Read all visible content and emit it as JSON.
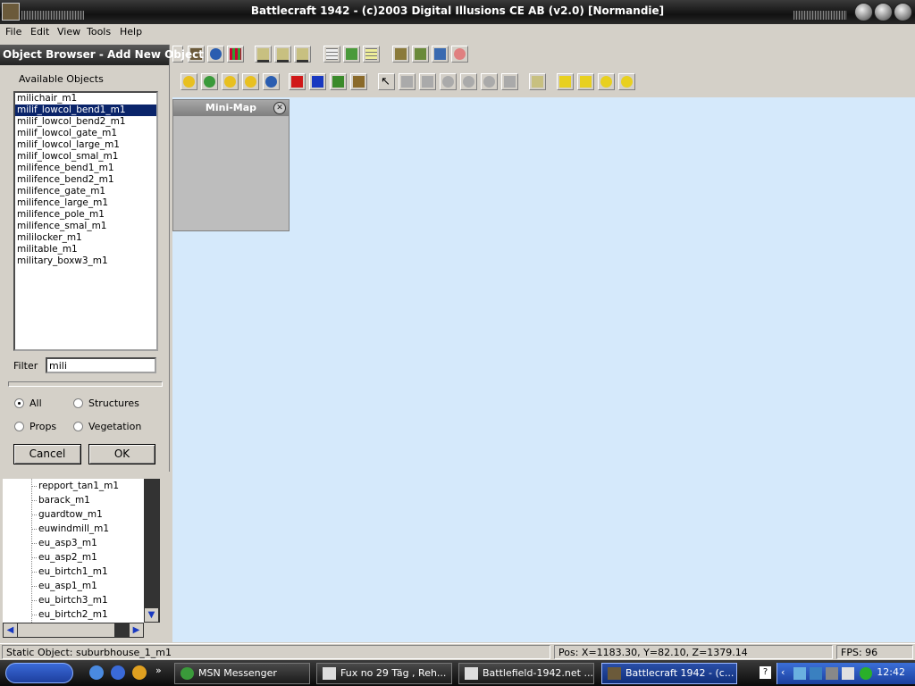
{
  "window": {
    "title": "Battlecraft 1942 - (c)2003 Digital Illusions CE AB (v2.0) [Normandie]"
  },
  "menu": [
    "File",
    "Edit",
    "View",
    "Tools",
    "Help"
  ],
  "dialog": {
    "title": "Object Browser - Add New Object",
    "list_label": "Available Objects",
    "objects": [
      "milichair_m1",
      "milif_lowcol_bend1_m1",
      "milif_lowcol_bend2_m1",
      "milif_lowcol_gate_m1",
      "milif_lowcol_large_m1",
      "milif_lowcol_smal_m1",
      "milifence_bend1_m1",
      "milifence_bend2_m1",
      "milifence_gate_m1",
      "milifence_large_m1",
      "milifence_pole_m1",
      "milifence_smal_m1",
      "mililocker_m1",
      "militable_m1",
      "military_boxw3_m1"
    ],
    "selected_index": 1,
    "filter_label": "Filter",
    "filter_value": "mili",
    "radios": {
      "all": "All",
      "structures": "Structures",
      "props": "Props",
      "vegetation": "Vegetation"
    },
    "cancel_label": "Cancel",
    "ok_label": "OK"
  },
  "tree": {
    "items": [
      "repport_tan1_m1",
      "barack_m1",
      "guardtow_m1",
      "euwindmill_m1",
      "eu_asp3_m1",
      "eu_asp2_m1",
      "eu_birtch1_m1",
      "eu_asp1_m1",
      "eu_birtch3_m1",
      "eu_birtch2_m1"
    ]
  },
  "minimap": {
    "title": "Mini-Map"
  },
  "status": {
    "object": "Static Object: suburbhouse_1_m1",
    "pos": "Pos: X=1183.30, Y=82.10, Z=1379.14",
    "fps": "FPS: 96"
  },
  "taskbar": {
    "tasks": [
      "MSN Messenger",
      "Fux no 29 Täg , Reh...",
      "Battlefield-1942.net ...",
      "Battlecraft 1942 - (c..."
    ],
    "clock": "12:42"
  },
  "colors": {
    "viewport": "#d5e9fb",
    "selection": "#0a246a"
  }
}
